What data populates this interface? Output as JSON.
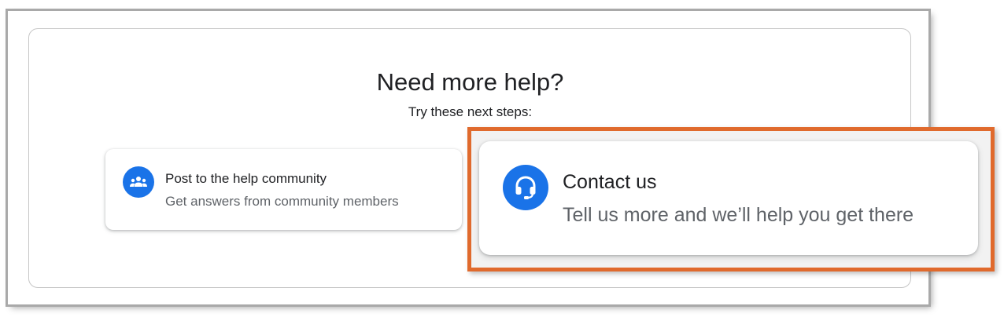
{
  "help": {
    "heading": "Need more help?",
    "subheading": "Try these next steps:"
  },
  "cards": {
    "community": {
      "title": "Post to the help community",
      "description": "Get answers from community members",
      "icon": "people-group-icon"
    },
    "contact": {
      "title": "Contact us",
      "description": "Tell us more and we’ll help you get there",
      "icon": "headset-icon"
    }
  },
  "colors": {
    "icon_background": "#1a73e8",
    "highlight_border": "#e06a2d",
    "title_text": "#202124",
    "secondary_text": "#5f6368"
  }
}
